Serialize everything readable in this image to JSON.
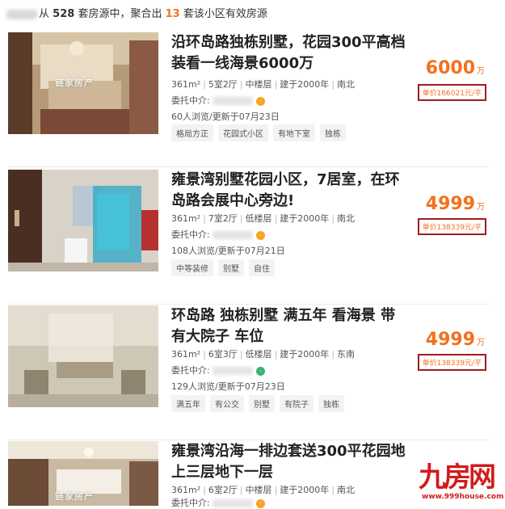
{
  "summary": {
    "prefix": "从",
    "total": "528",
    "middle": "套房源中，聚合出",
    "count": "13",
    "suffix": "套该小区有效房源"
  },
  "listings": [
    {
      "title": "沿环岛路独栋别墅，花园300平高档装看一线海景6000万",
      "area": "361m²",
      "layout": "5室2厅",
      "floor": "中楼层",
      "built": "建于2000年",
      "orient": "南北",
      "agent_label": "委托中介:",
      "views": "60人浏览",
      "updated": "更新于07月23日",
      "tags": [
        "格局方正",
        "花园式小区",
        "有地下室",
        "独栋"
      ],
      "price": "6000",
      "price_unit": "万",
      "unit_price": "单价166021元/平"
    },
    {
      "title": "雍景湾别墅花园小区，7居室，在环岛路会展中心旁边!",
      "area": "361m²",
      "layout": "7室2厅",
      "floor": "低楼层",
      "built": "建于2000年",
      "orient": "南北",
      "agent_label": "委托中介:",
      "views": "108人浏览",
      "updated": "更新于07月21日",
      "tags": [
        "中等装修",
        "别墅",
        "自住"
      ],
      "price": "4999",
      "price_unit": "万",
      "unit_price": "单价138339元/平"
    },
    {
      "title": "环岛路 独栋别墅 满五年 看海景 带有大院子 车位",
      "area": "361m²",
      "layout": "6室3厅",
      "floor": "低楼层",
      "built": "建于2000年",
      "orient": "东南",
      "agent_label": "委托中介:",
      "views": "129人浏览",
      "updated": "更新于07月23日",
      "tags": [
        "满五年",
        "有公交",
        "别墅",
        "有院子",
        "独栋"
      ],
      "price": "4999",
      "price_unit": "万",
      "unit_price": "单价138339元/平"
    },
    {
      "title": "雍景湾沿海一排边套送300平花园地上三层地下一层",
      "area": "361m²",
      "layout": "6室2厅",
      "floor": "中楼层",
      "built": "建于2000年",
      "orient": "南北",
      "agent_label": "委托中介:",
      "views": "",
      "updated": "",
      "tags": [],
      "price": "",
      "price_unit": "",
      "unit_price": ""
    }
  ],
  "watermark": "链家房产",
  "logo": {
    "text": "九房网",
    "url": "www.999house.com"
  },
  "colors": {
    "accent": "#f2711c",
    "highlight_border": "#a11d1d",
    "logo_red": "#d21c1c"
  }
}
